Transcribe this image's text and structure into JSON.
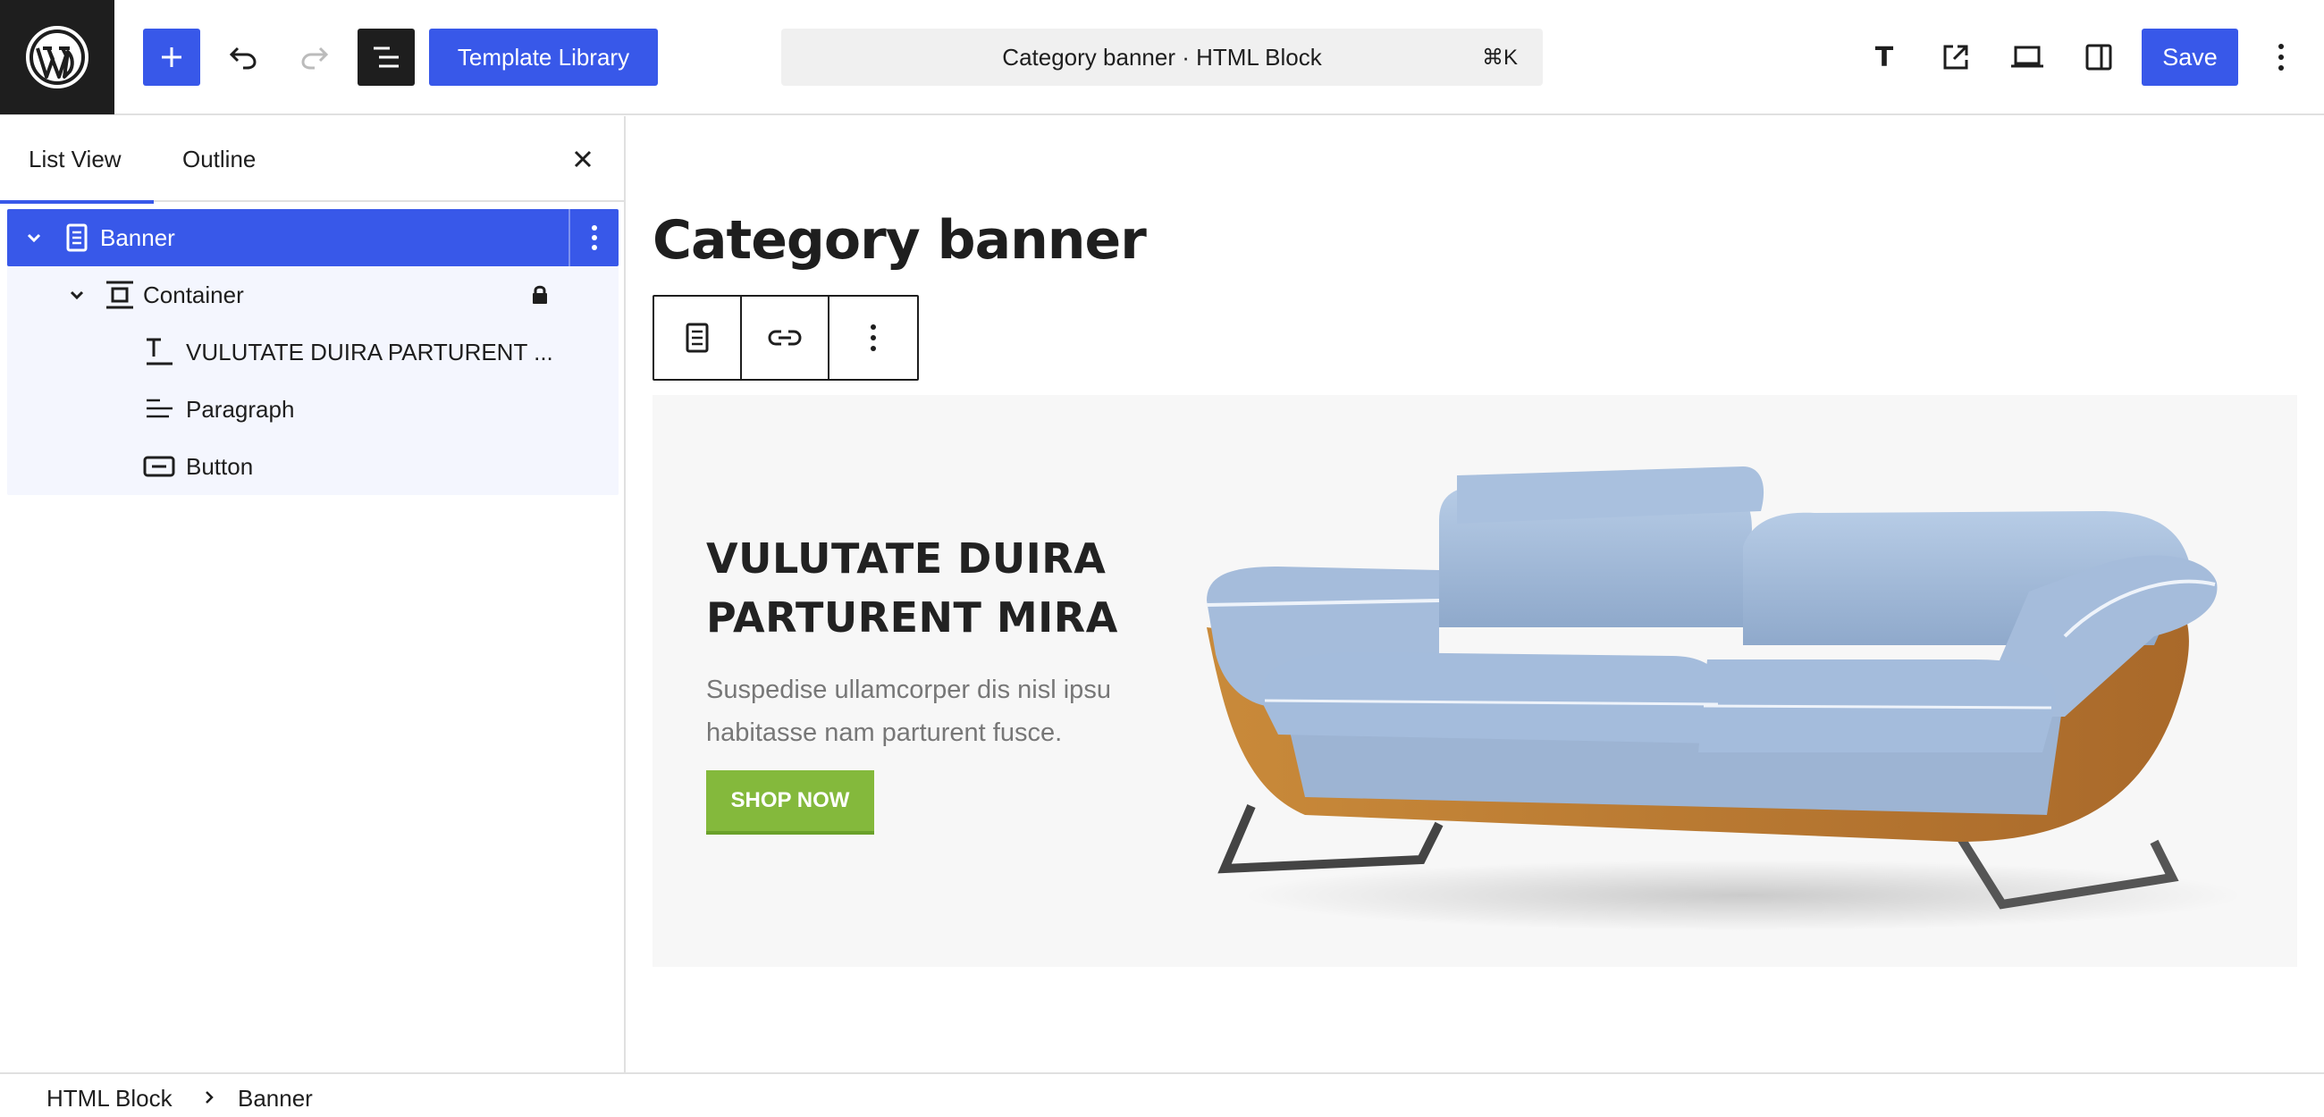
{
  "header": {
    "template_library_label": "Template Library",
    "command_bar": {
      "title": "Category banner · HTML Block",
      "shortcut": "⌘K"
    },
    "typography_label": "T",
    "save_label": "Save",
    "accent_color": "#3858e9",
    "icons": [
      "wordpress-logo-icon",
      "plus-icon",
      "undo-icon",
      "redo-icon",
      "list-view-icon",
      "external-link-icon",
      "desktop-icon",
      "sidebar-icon",
      "more-vertical-icon"
    ]
  },
  "sidebar": {
    "tabs": [
      {
        "label": "List View",
        "active": true
      },
      {
        "label": "Outline",
        "active": false
      }
    ],
    "tree": [
      {
        "label": "Banner",
        "level": 0,
        "icon": "page-icon",
        "selected": true,
        "expanded": true
      },
      {
        "label": "Container",
        "level": 1,
        "icon": "group-icon",
        "expanded": true,
        "locked": true
      },
      {
        "label": "VULUTATE DUIRA PARTURENT ...",
        "level": 2,
        "icon": "heading-icon"
      },
      {
        "label": "Paragraph",
        "level": 2,
        "icon": "paragraph-icon"
      },
      {
        "label": "Button",
        "level": 2,
        "icon": "button-icon"
      }
    ]
  },
  "canvas": {
    "page_title": "Category banner",
    "banner": {
      "heading": "VULUTATE DUIRA PARTURENT MIRA",
      "text": "Suspedise ullamcorper dis nisl ipsu habitasse nam parturent fusce.",
      "button_label": "SHOP NOW",
      "button_color": "#84b93c"
    }
  },
  "footer": {
    "breadcrumb": [
      "HTML Block",
      "Banner"
    ]
  }
}
